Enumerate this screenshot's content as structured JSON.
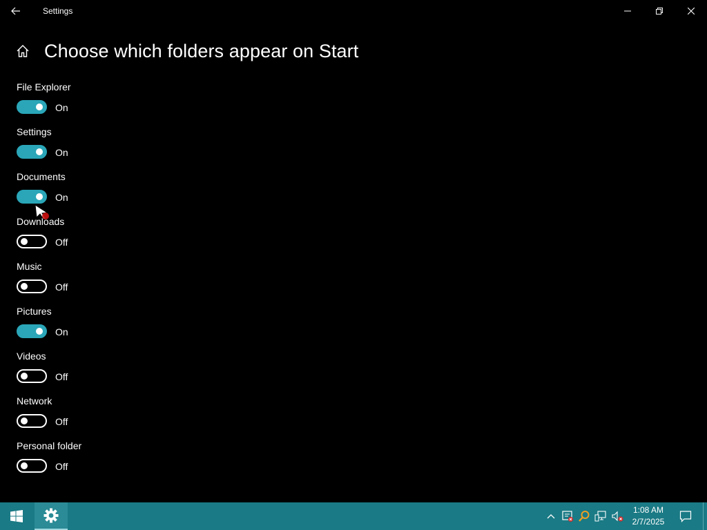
{
  "window": {
    "title": "Settings"
  },
  "page": {
    "title": "Choose which folders appear on Start"
  },
  "folders": [
    {
      "label": "File Explorer",
      "state": "On",
      "on": true
    },
    {
      "label": "Settings",
      "state": "On",
      "on": true
    },
    {
      "label": "Documents",
      "state": "On",
      "on": true
    },
    {
      "label": "Downloads",
      "state": "Off",
      "on": false
    },
    {
      "label": "Music",
      "state": "Off",
      "on": false
    },
    {
      "label": "Pictures",
      "state": "On",
      "on": true
    },
    {
      "label": "Videos",
      "state": "Off",
      "on": false
    },
    {
      "label": "Network",
      "state": "Off",
      "on": false
    },
    {
      "label": "Personal folder",
      "state": "Off",
      "on": false
    }
  ],
  "taskbar": {
    "time": "1:08 AM",
    "date": "2/7/2025",
    "icons": [
      "windows-start-icon",
      "settings-gear-icon",
      "chevron-up-icon",
      "security-icon",
      "search-icon",
      "network-icon",
      "volume-muted-icon",
      "notification-icon"
    ]
  },
  "colors": {
    "accent": "#2aa6b8",
    "background": "#000000",
    "taskbar": "#1a7a85",
    "text": "#ffffff"
  }
}
